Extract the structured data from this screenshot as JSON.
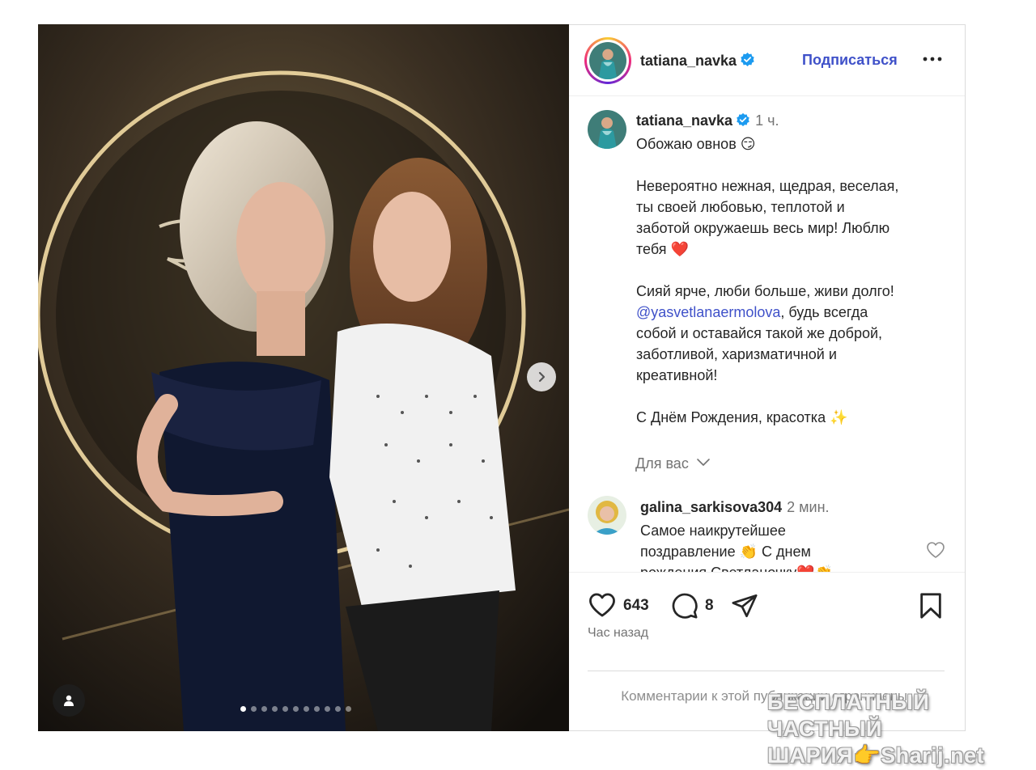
{
  "post": {
    "author": "tatiana_navka",
    "subscribe_label": "Подписаться",
    "time": "1 ч.",
    "caption_lines": [
      "Обожаю овнов 😏",
      "",
      "Невероятно нежная, щедрая, веселая,",
      "ты своей любовью, теплотой и",
      "заботой окружаешь весь мир! Люблю",
      "тебя ❤️",
      "",
      "Сияй ярче, люби больше, живи долго!"
    ],
    "mention": "@yasvetlanaermolova",
    "caption_after_mention": ", будь всегда",
    "caption_lines_2": [
      "собой и оставайся такой же доброй,",
      "заботливой, харизматичной и",
      "креативной!",
      "",
      "С Днём Рождения, красотка ✨"
    ],
    "for_you_label": "Для вас",
    "likes": "643",
    "comments_count": "8",
    "time_ago": "Час назад",
    "comments_closed": "Комментарии к этой публикации ограничены."
  },
  "comment": {
    "user": "galina_sarkisova304",
    "time": "2 мин.",
    "text": "Самое наикрутейшее поздравление 👏 С днем рождения Светланочку❤️👏"
  },
  "carousel": {
    "slides": 11,
    "active_index": 0
  },
  "watermark": {
    "line1": "БЕСПЛАТНЫЙ ЧАСТНЫЙ",
    "line2": "ШАРИЯ👉Sharij.net"
  },
  "colors": {
    "link": "#3f51c9",
    "verified": "#1d9bf0",
    "muted": "#737373",
    "like_red": "#e0245e"
  },
  "icons": [
    "chevron-right-icon",
    "user-tag-icon",
    "verified-badge-icon",
    "more-icon",
    "heart-icon",
    "comment-icon",
    "share-icon",
    "bookmark-icon",
    "chevron-down-icon"
  ]
}
